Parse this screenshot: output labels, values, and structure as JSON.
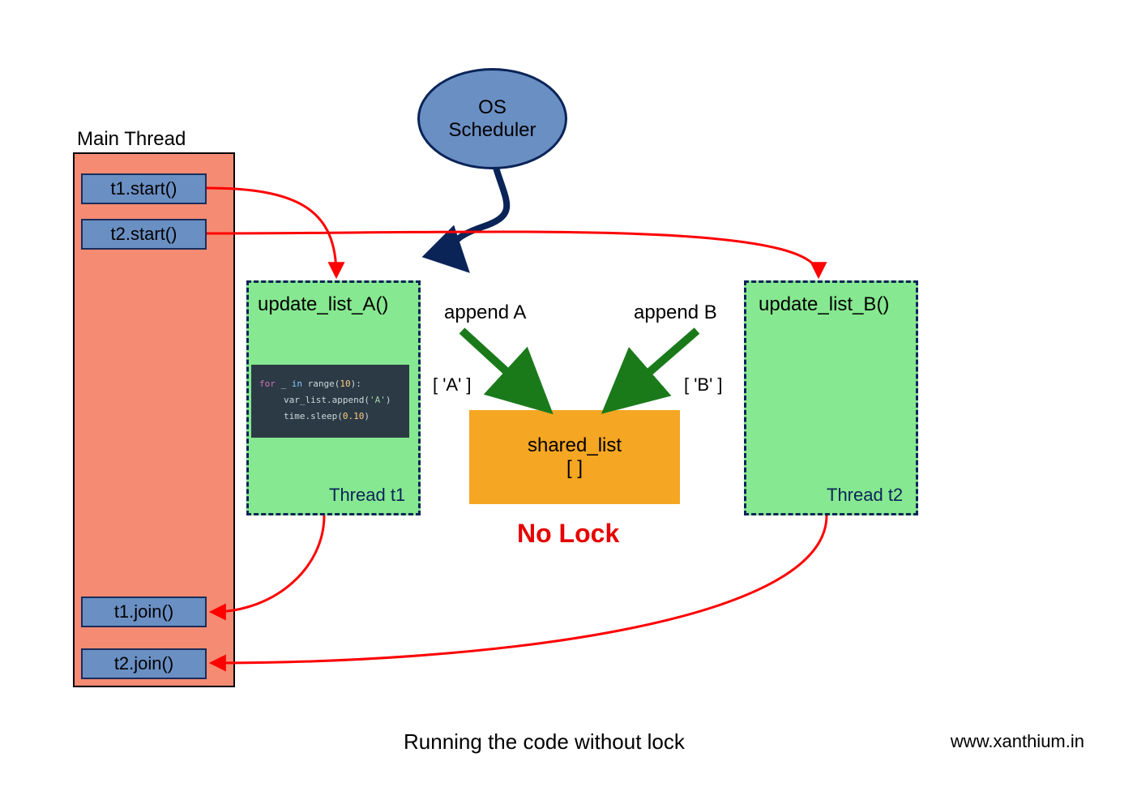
{
  "mainThread": {
    "label": "Main Thread",
    "buttons": {
      "t1start": "t1.start()",
      "t2start": "t2.start()",
      "t1join": "t1.join()",
      "t2join": "t2.join()"
    }
  },
  "scheduler": {
    "line1": "OS",
    "line2": "Scheduler"
  },
  "threads": {
    "t1": {
      "func": "update_list_A()",
      "label": "Thread t1",
      "code": {
        "line1_for": "for",
        "line1_underscore": " _ ",
        "line1_in": "in",
        "line1_range": " range(",
        "line1_num": "10",
        "line1_close": "):",
        "line2": "var_list.append(",
        "line2_str": "'A'",
        "line2_close": ")",
        "line3": "time.sleep(",
        "line3_num": "0.10",
        "line3_close": ")"
      }
    },
    "t2": {
      "func": "update_list_B()",
      "label": "Thread t2"
    }
  },
  "appendLabels": {
    "a": "append A",
    "b": "append B"
  },
  "valLabels": {
    "a": "[ 'A' ]",
    "b": "[ 'B' ]"
  },
  "sharedList": {
    "line1": "shared_list",
    "line2": "[ ]"
  },
  "noLock": "No Lock",
  "caption": "Running the code without lock",
  "website": "www.xanthium.in",
  "colors": {
    "mainThreadBg": "#f58b73",
    "buttonBg": "#6a8fc3",
    "threadBg": "#86e890",
    "sharedBg": "#f5a623",
    "noLockColor": "#e60000",
    "darkBlue": "#0a2458",
    "green": "#1a7a1a",
    "red": "#ff0000"
  }
}
